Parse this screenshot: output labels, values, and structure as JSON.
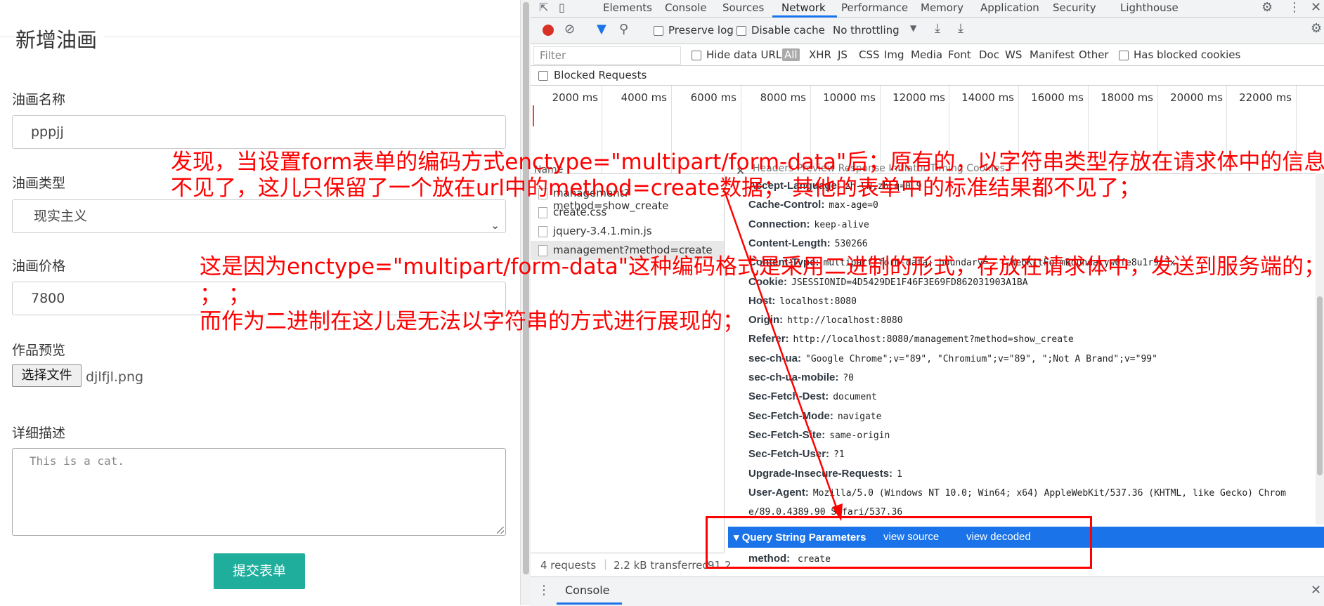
{
  "form": {
    "legend": "新增油画",
    "name_label": "油画名称",
    "name_value": "pppjj",
    "type_label": "油画类型",
    "type_value": "现实主义",
    "price_label": "油画价格",
    "price_value": "7800",
    "preview_label": "作品预览",
    "file_button": "选择文件",
    "file_name": "djlfjl.png",
    "desc_label": "详细描述",
    "desc_placeholder": "This is a cat.",
    "submit_label": "提交表单"
  },
  "devtools": {
    "tabs": [
      "Elements",
      "Console",
      "Sources",
      "Network",
      "Performance",
      "Memory",
      "Application",
      "Security",
      "Lighthouse"
    ],
    "active_tab": "Network",
    "toolbar": {
      "preserve_log": "Preserve log",
      "disable_cache": "Disable cache",
      "throttling": "No throttling"
    },
    "filter": {
      "placeholder": "Filter",
      "hide_data_urls": "Hide data URLs",
      "types": [
        "All",
        "XHR",
        "JS",
        "CSS",
        "Img",
        "Media",
        "Font",
        "Doc",
        "WS",
        "Manifest",
        "Other"
      ],
      "has_blocked_cookies": "Has blocked cookies",
      "blocked_requests": "Blocked Requests"
    },
    "timeline_ticks": [
      "2000 ms",
      "4000 ms",
      "6000 ms",
      "8000 ms",
      "10000 ms",
      "12000 ms",
      "14000 ms",
      "16000 ms",
      "18000 ms",
      "20000 ms",
      "22000 ms"
    ],
    "name_header": "Name",
    "requests": [
      "management?method=show_create",
      "create.css",
      "jquery-3.4.1.min.js",
      "management?method=create"
    ],
    "detail_tabs": "Headers   Preview   Response   Initiator   Timing   Cookies",
    "headers": [
      {
        "k": "Accept-Language:",
        "v": "zh-CN,zh;q=0.9"
      },
      {
        "k": "Cache-Control:",
        "v": "max-age=0"
      },
      {
        "k": "Connection:",
        "v": "keep-alive"
      },
      {
        "k": "Content-Length:",
        "v": "530266"
      },
      {
        "k": "Content-Type:",
        "v": "multipart/form-data; boundary=----WebKitFormBoundaryw0fe8u1r9z3x"
      },
      {
        "k": "Cookie:",
        "v": "JSESSIONID=4D5429DE1F46F3E69FD862031903A1BA"
      },
      {
        "k": "Host:",
        "v": "localhost:8080"
      },
      {
        "k": "Origin:",
        "v": "http://localhost:8080"
      },
      {
        "k": "Referer:",
        "v": "http://localhost:8080/management?method=show_create"
      },
      {
        "k": "sec-ch-ua:",
        "v": "\"Google Chrome\";v=\"89\", \"Chromium\";v=\"89\", \";Not A Brand\";v=\"99\""
      },
      {
        "k": "sec-ch-ua-mobile:",
        "v": "?0"
      },
      {
        "k": "Sec-Fetch-Dest:",
        "v": "document"
      },
      {
        "k": "Sec-Fetch-Mode:",
        "v": "navigate"
      },
      {
        "k": "Sec-Fetch-Site:",
        "v": "same-origin"
      },
      {
        "k": "Sec-Fetch-User:",
        "v": "?1"
      },
      {
        "k": "Upgrade-Insecure-Requests:",
        "v": "1"
      },
      {
        "k": "User-Agent:",
        "v": "Mozilla/5.0 (Windows NT 10.0; Win64; x64) AppleWebKit/537.36 (KHTML, like Gecko) Chrom"
      },
      {
        "k": "",
        "v": "e/89.0.4389.90 Safari/537.36"
      }
    ],
    "query_section": {
      "title": "▾ Query String Parameters",
      "view_source": "view source",
      "view_decoded": "view decoded",
      "param_key": "method:",
      "param_value": "create"
    },
    "status": {
      "requests": "4 requests",
      "transferred": "2.2 kB transferred",
      "extra": "91.2"
    },
    "console_tab": "Console"
  },
  "annotations": {
    "note1_line1": "发现，当设置form表单的编码方式enctype=\"multipart/form-data\"后；原有的，以字符串类型存放在请求体中的信息全都",
    "note1_line2": "不见了，这儿只保留了一个放在url中的method=create数据；  其他的表单中的标准结果都不见了；",
    "note2_line1": "这是因为enctype=\"multipart/form-data\"这种编码格式是采用二进制的形式，存放在请求体中，发送到服务端的；",
    "note2_line2": "；  ；",
    "note2_line3": "而作为二进制在这儿是无法以字符串的方式进行展现的；",
    "color": "#ff0000"
  },
  "theme": {
    "accent": "#1a73e8",
    "submit_color": "#1fae9c",
    "record_color": "#d93025"
  }
}
